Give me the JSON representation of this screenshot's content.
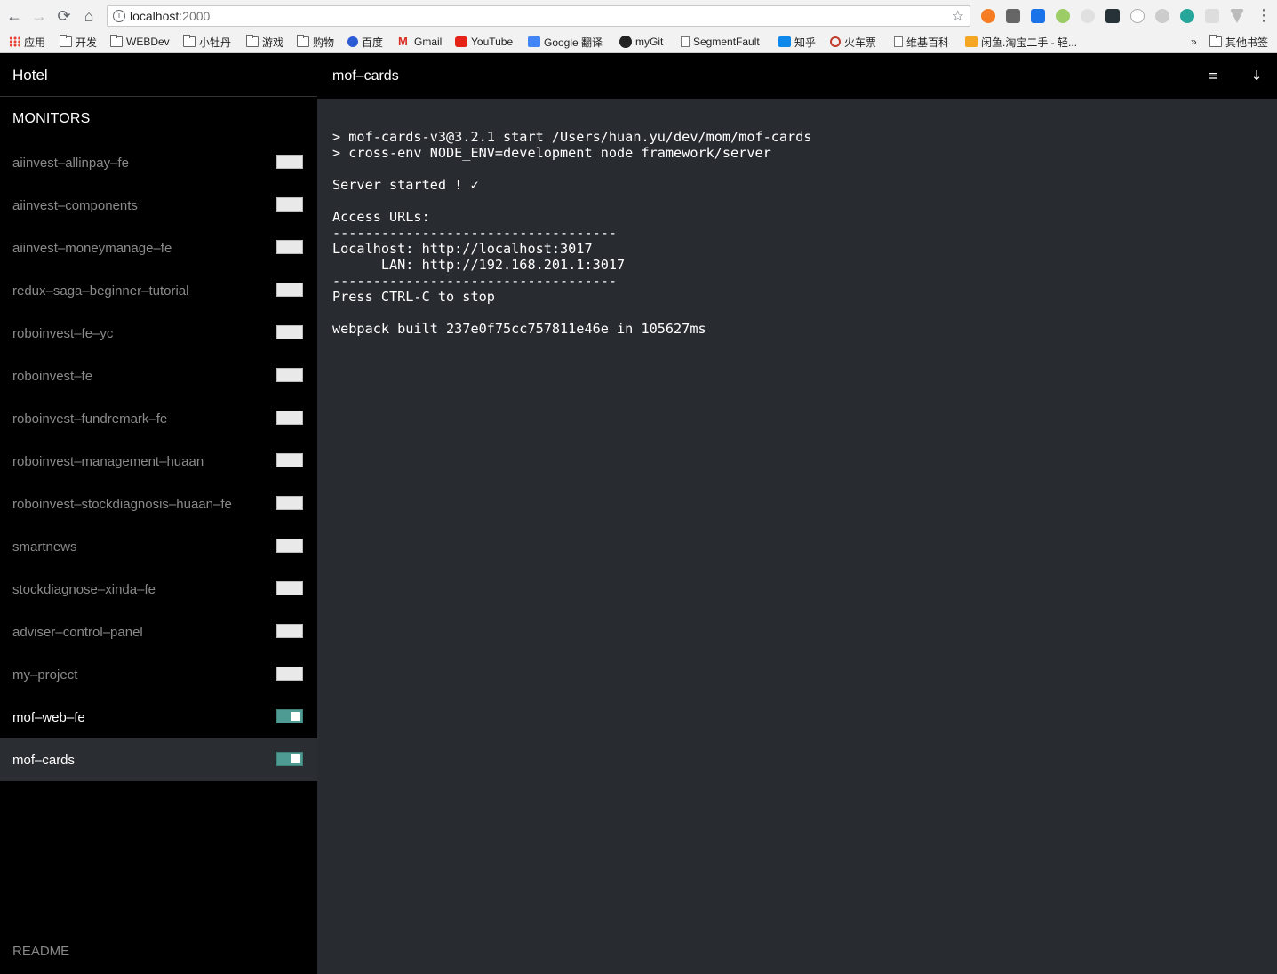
{
  "browser": {
    "url_host": "localhost",
    "url_port": ":2000",
    "bookmarks": [
      {
        "label": "应用",
        "icon": "apps-grid-icon"
      },
      {
        "label": "开发",
        "icon": "folder-icon"
      },
      {
        "label": "WEBDev",
        "icon": "folder-icon"
      },
      {
        "label": "小牡丹",
        "icon": "folder-icon"
      },
      {
        "label": "游戏",
        "icon": "folder-icon"
      },
      {
        "label": "购物",
        "icon": "folder-icon"
      },
      {
        "label": "百度",
        "icon": "baidu-icon"
      },
      {
        "label": "Gmail",
        "icon": "gmail-icon"
      },
      {
        "label": "YouTube",
        "icon": "youtube-icon"
      },
      {
        "label": "Google 翻译",
        "icon": "google-translate-icon"
      },
      {
        "label": "myGit",
        "icon": "github-icon"
      },
      {
        "label": "SegmentFault",
        "icon": "page-icon"
      },
      {
        "label": "知乎",
        "icon": "zhihu-icon"
      },
      {
        "label": "火车票",
        "icon": "train-ticket-icon"
      },
      {
        "label": "维基百科",
        "icon": "page-icon"
      },
      {
        "label": "闲鱼.淘宝二手 - 轻...",
        "icon": "xianyu-icon"
      }
    ],
    "more_bookmarks": "»",
    "other_bookmarks": "其他书签"
  },
  "sidebar": {
    "title": "Hotel",
    "section_title": "MONITORS",
    "readme_label": "README",
    "monitors": [
      {
        "name": "aiinvest–allinpay–fe",
        "enabled": false,
        "selected": false
      },
      {
        "name": "aiinvest–components",
        "enabled": false,
        "selected": false
      },
      {
        "name": "aiinvest–moneymanage–fe",
        "enabled": false,
        "selected": false
      },
      {
        "name": "redux–saga–beginner–tutorial",
        "enabled": false,
        "selected": false
      },
      {
        "name": "roboinvest–fe–yc",
        "enabled": false,
        "selected": false
      },
      {
        "name": "roboinvest–fe",
        "enabled": false,
        "selected": false
      },
      {
        "name": "roboinvest–fundremark–fe",
        "enabled": false,
        "selected": false
      },
      {
        "name": "roboinvest–management–huaan",
        "enabled": false,
        "selected": false
      },
      {
        "name": "roboinvest–stockdiagnosis–huaan–fe",
        "enabled": false,
        "selected": false
      },
      {
        "name": "smartnews",
        "enabled": false,
        "selected": false
      },
      {
        "name": "stockdiagnose–xinda–fe",
        "enabled": false,
        "selected": false
      },
      {
        "name": "adviser–control–panel",
        "enabled": false,
        "selected": false
      },
      {
        "name": "my–project",
        "enabled": false,
        "selected": false
      },
      {
        "name": "mof–web–fe",
        "enabled": true,
        "selected": false
      },
      {
        "name": "mof–cards",
        "enabled": true,
        "selected": true
      }
    ],
    "toggle_on_color": "#4d9b92"
  },
  "main": {
    "title": "mof–cards",
    "console_lines": [
      "> mof-cards-v3@3.2.1 start /Users/huan.yu/dev/mom/mof-cards",
      "> cross-env NODE_ENV=development node framework/server",
      "",
      "Server started ! ✓",
      "",
      "Access URLs:",
      "-----------------------------------",
      "Localhost: http://localhost:3017",
      "      LAN: http://192.168.201.1:3017",
      "-----------------------------------",
      "Press CTRL-C to stop",
      "",
      "webpack built 237e0f75cc757811e46e in 105627ms"
    ],
    "background_color": "#282c30"
  }
}
